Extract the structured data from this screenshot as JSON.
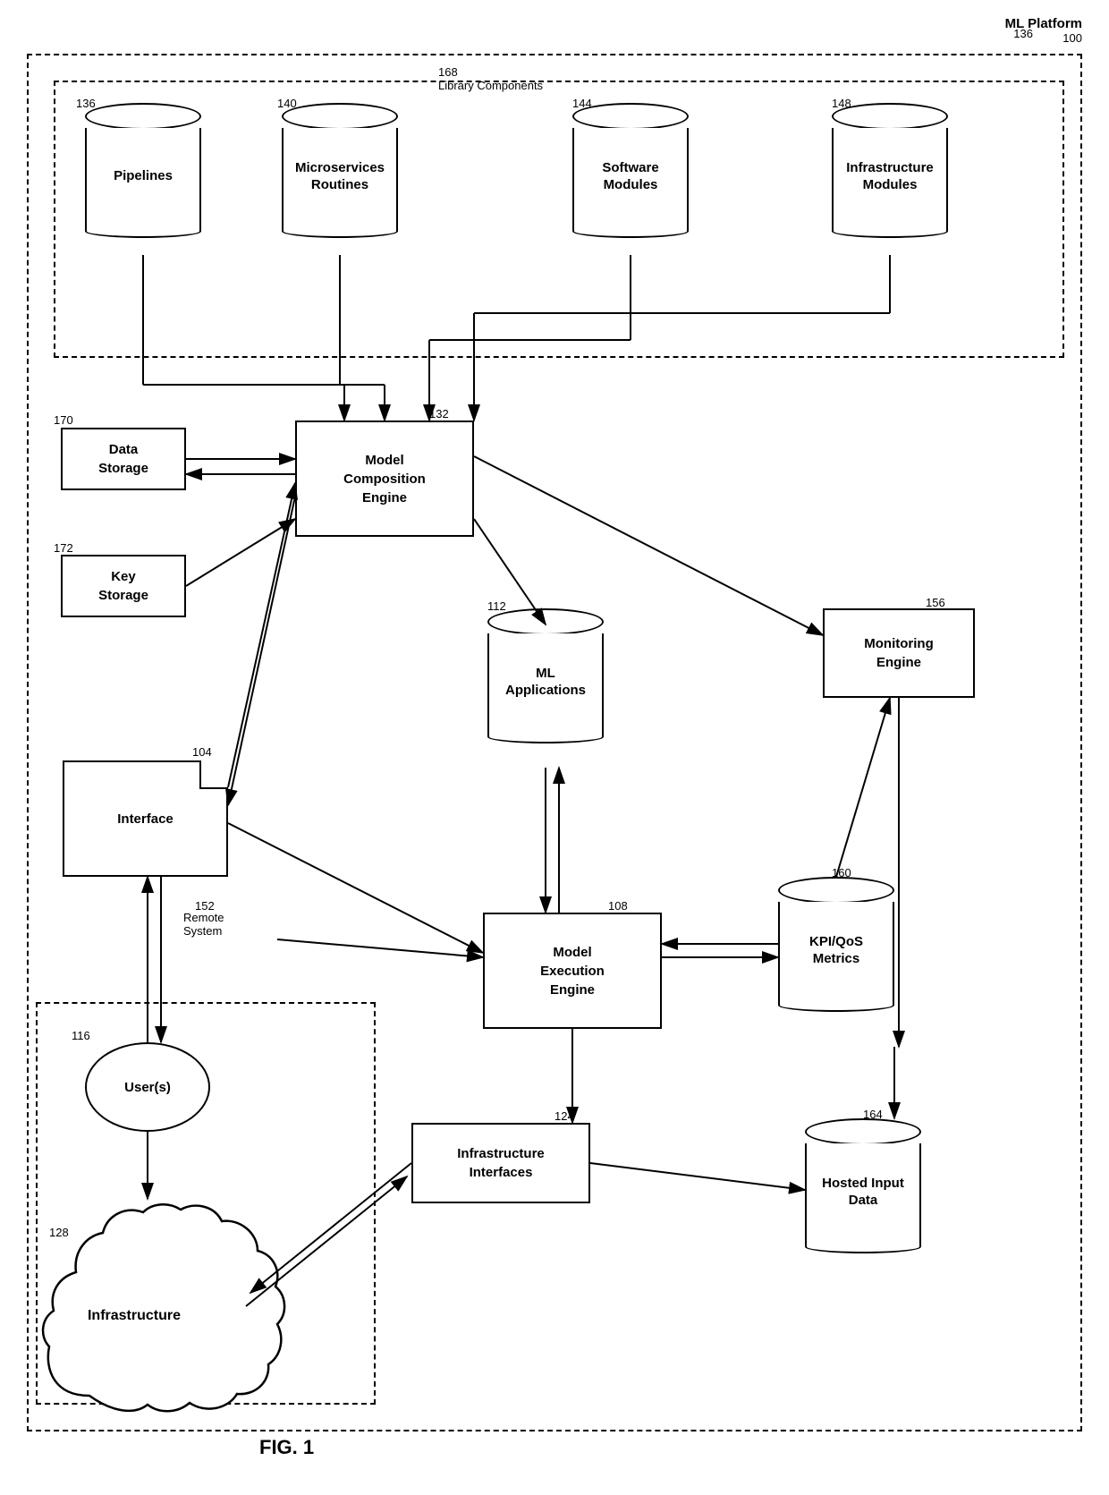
{
  "diagram": {
    "title": "FIG. 1",
    "ml_platform_label": "ML Platform",
    "ml_platform_ref": "100",
    "library_label": "Library Components",
    "library_ref": "168",
    "components": {
      "pipelines": {
        "label": "Pipelines",
        "ref": "136"
      },
      "microservices": {
        "label": "Microservices\nRoutines",
        "ref": "140"
      },
      "software_modules": {
        "label": "Software\nModules",
        "ref": "144"
      },
      "infrastructure_modules": {
        "label": "Infrastructure\nModules",
        "ref": "148"
      },
      "model_composition": {
        "label": "Model\nComposition\nEngine",
        "ref": "132"
      },
      "data_storage": {
        "label": "Data\nStorage",
        "ref": "170"
      },
      "key_storage": {
        "label": "Key\nStorage",
        "ref": "172"
      },
      "ml_applications": {
        "label": "ML\nApplications",
        "ref": "112"
      },
      "monitoring_engine": {
        "label": "Monitoring\nEngine",
        "ref": "156"
      },
      "interface": {
        "label": "Interface",
        "ref": "104"
      },
      "model_execution": {
        "label": "Model\nExecution\nEngine",
        "ref": "108"
      },
      "kpi_qos": {
        "label": "KPI/QoS\nMetrics",
        "ref": "160"
      },
      "infrastructure_interfaces": {
        "label": "Infrastructure\nInterfaces",
        "ref": "124"
      },
      "hosted_input": {
        "label": "Hosted Input\nData",
        "ref": "164"
      },
      "users": {
        "label": "User(s)",
        "ref": "116"
      },
      "infrastructure": {
        "label": "Infrastructure",
        "ref": "128"
      },
      "remote_system": {
        "label": "Remote\nSystem",
        "ref": "152"
      }
    }
  }
}
